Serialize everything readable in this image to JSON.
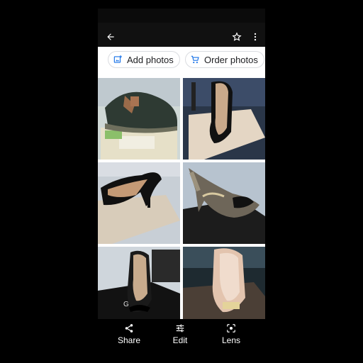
{
  "toolbar": {
    "back_icon": "arrow-back-icon",
    "star_icon": "star-outline-icon",
    "more_icon": "more-vert-icon"
  },
  "chips": {
    "add_photos": "Add photos",
    "order_photos": "Order photos"
  },
  "photos": [
    {
      "subject": "dark green child shoe with brown strap on box"
    },
    {
      "subject": "black patent pump with studs on box"
    },
    {
      "subject": "black patent studded pump on box"
    },
    {
      "subject": "black glitter pump with bow"
    },
    {
      "subject": "black pump with bow on box"
    },
    {
      "subject": "nude pump with bow on box"
    }
  ],
  "actions": {
    "share": "Share",
    "edit": "Edit",
    "lens": "Lens"
  },
  "colors": {
    "accent_blue": "#1a73e8",
    "chip_border": "#dadce0"
  }
}
